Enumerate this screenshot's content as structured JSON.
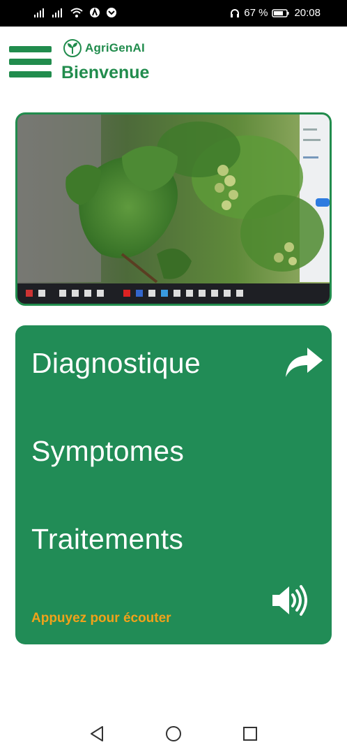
{
  "status_bar": {
    "battery_percent": "67 %",
    "time": "20:08",
    "icons": [
      "signal-icon",
      "signal-icon",
      "wifi-icon",
      "app-notification-icon",
      "app-notification-icon",
      "headphones-icon",
      "battery-icon"
    ]
  },
  "header": {
    "app_name": "AgriGenAI",
    "welcome": "Bienvenue",
    "menu_icon": "hamburger-menu-icon",
    "logo_icon": "leaf-logo-icon"
  },
  "photo": {
    "subject": "plant-leaves-photo"
  },
  "diagnostic_card": {
    "title_diagnostic": "Diagnostique",
    "title_symptoms": "Symptomes",
    "title_treatments": "Traitements",
    "listen_hint": "Appuyez pour écouter",
    "share_icon": "share-arrow-icon",
    "speaker_icon": "speaker-icon",
    "background_color": "#218c56",
    "hint_color": "#f1a21a"
  },
  "nav_bar": {
    "buttons": [
      "back-icon",
      "home-icon",
      "recent-apps-icon"
    ]
  },
  "colors": {
    "brand_green": "#218c4d",
    "card_green": "#218c56",
    "accent_orange": "#f1a21a"
  }
}
